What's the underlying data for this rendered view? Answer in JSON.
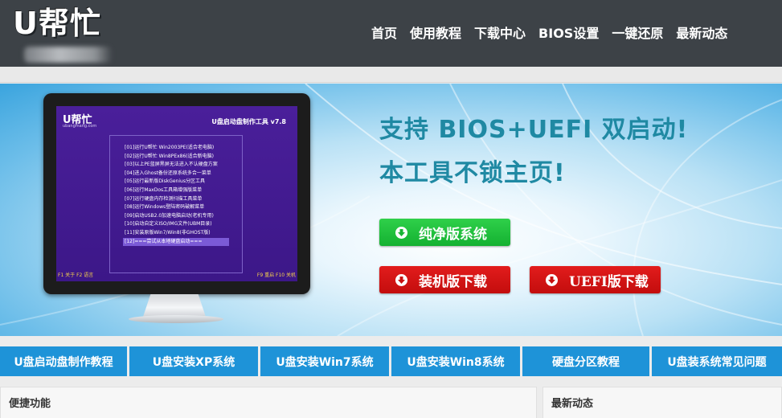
{
  "header": {
    "logo_text": "U帮忙",
    "nav": [
      "首页",
      "使用教程",
      "下载中心",
      "BIOS设置",
      "一键还原",
      "最新动态"
    ]
  },
  "banner": {
    "headline1": "支持 BIOS+UEFI 双启动!",
    "headline2": "本工具不锁主页!",
    "buttons": {
      "pure": "纯净版系统",
      "install": "装机版下载",
      "uefi": "UEFI版下载"
    },
    "screen": {
      "logo": "U帮忙",
      "url": "ubangmang.com",
      "title": "U盘启动盘制作工具 v7.8",
      "menu": [
        "[01]运行U帮忙 Win2003PE(适合老电脑)",
        "[02]运行U帮忙 Win8PEx86(适合新电脑)",
        "[03]以上PE蓝屏黑屏无法进入不认硬盘方案",
        "[04]进入Ghost备份还原系统多合一菜单",
        "[05]运行最新版DiskGenius分区工具",
        "[06]运行MaxDos工具箱增强版菜单",
        "[07]运行硬盘内存检测扫描工具菜单",
        "[08]运行Windows登陆密码破解菜单",
        "[09]启动USB2.0加速电脑启动(老机专用)",
        "[10]启动自定义ISO/IMG文件(UBM目录)",
        "[11]安装原版Win7/Win8(非GHOST版)",
        "[12]===尝试从本地硬盘启动==="
      ],
      "footer_left": "F1 关于   F2 语言",
      "footer_right": "F9 重启   F10 关机"
    },
    "colors": {
      "headline": "#1f89a3",
      "green": "#18b434",
      "red": "#c81010"
    }
  },
  "tabs": [
    "U盘启动盘制作教程",
    "U盘安装XP系统",
    "U盘安装Win7系统",
    "U盘安装Win8系统",
    "硬盘分区教程",
    "U盘装系统常见问题"
  ],
  "panels": {
    "left_title": "便捷功能",
    "right_title": "最新动态"
  },
  "icons": {
    "download": "download-icon"
  }
}
